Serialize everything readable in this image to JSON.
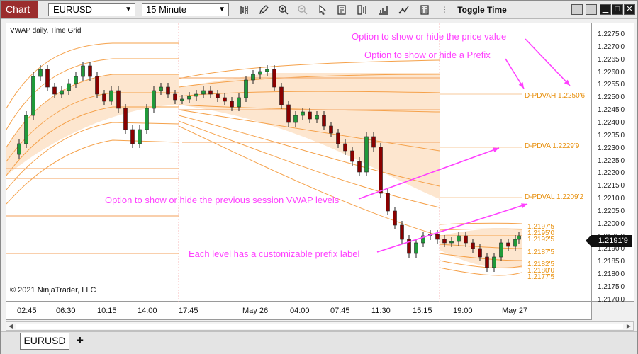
{
  "toolbar": {
    "chart_tab_label": "Chart",
    "instrument": "EURUSD",
    "interval": "15 Minute",
    "toggle_time_label": "Toggle Time",
    "icons": [
      "bar-type-icon",
      "draw-pencil-icon",
      "zoom-in-icon",
      "zoom-out-icon",
      "pointer-icon",
      "data-box-icon",
      "chart-style-icon",
      "indicators-icon",
      "strategies-icon",
      "properties-icon"
    ]
  },
  "chart": {
    "indicator_label": "VWAP daily, Time Grid",
    "copyright": "© 2021 NinjaTrader, LLC",
    "current_price": "1.2191'9",
    "colors": {
      "vwap": "#f5a14a",
      "fill": "#fde6cf",
      "annotation": "#ff40ff",
      "candle_up": "#1f9a3a",
      "candle_down": "#8b0000"
    }
  },
  "price_axis": {
    "ticks": [
      "1.2275'0",
      "1.2270'0",
      "1.2265'0",
      "1.2260'0",
      "1.2255'0",
      "1.2250'0",
      "1.2245'0",
      "1.2240'0",
      "1.2235'0",
      "1.2230'0",
      "1.2225'0",
      "1.2220'0",
      "1.2215'0",
      "1.2210'0",
      "1.2205'0",
      "1.2200'0",
      "1.2195'0",
      "1.2190'0",
      "1.2185'0",
      "1.2180'0",
      "1.2175'0",
      "1.2170'0"
    ]
  },
  "time_axis": {
    "ticks": [
      "02:45",
      "06:30",
      "10:15",
      "14:00",
      "17:45",
      "May 26",
      "04:00",
      "07:45",
      "11:30",
      "15:15",
      "19:00",
      "May 27"
    ]
  },
  "levels": {
    "previous": [
      "D-PDVAH 1.2250'6",
      "D-PDVA 1.2229'9",
      "D-PDVAL 1.2209'2"
    ],
    "current": [
      "1.2197'5",
      "1.2195'0",
      "1.2192'5",
      "1.2187'5",
      "1.2182'5",
      "1.2180'0",
      "1.2177'5"
    ]
  },
  "annotations": {
    "price_value": "Option to show or hide the price value",
    "prefix": "Option to show or hide a Prefix",
    "previous_session": "Option to show or hide the previous session VWAP levels",
    "prefix_label": "Each level has a customizable prefix label"
  },
  "tabs": {
    "instrument_tab": "EURUSD",
    "add_tab": "+"
  }
}
